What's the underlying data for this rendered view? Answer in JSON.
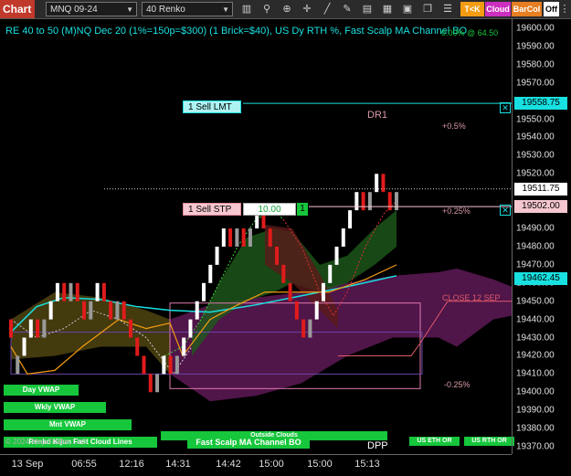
{
  "toolbar": {
    "title": "Chart",
    "instrument": "MNQ 09-24",
    "bar_type": "40 Renko",
    "tk_label": "T<K",
    "cloud_label": "Cloud",
    "barcol_label": "BarCol",
    "off_label": "Off",
    "colors": {
      "title_bg": "#c0392b",
      "tk": "#f39c12",
      "cloud": "#cc2fbf",
      "barcol": "#e67e22"
    }
  },
  "chart_title": "RE 40 to 50 (M)NQ Dec 20 (1%=150p=$300) (1 Brick=$40), US Dy RTH %, Fast Scalp MA Channel BO",
  "overlay_top_right": "0.00% @ 64.50",
  "price_axis": {
    "ticks": [
      "19600.00",
      "19590.00",
      "19580.00",
      "19570.00",
      "19560.00",
      "19550.00",
      "19540.00",
      "19530.00",
      "19520.00",
      "19510.00",
      "19500.00",
      "19490.00",
      "19480.00",
      "19470.00",
      "19460.00",
      "19450.00",
      "19440.00",
      "19430.00",
      "19420.00",
      "19410.00",
      "19400.00",
      "19390.00",
      "19380.00",
      "19370.00"
    ],
    "flags": [
      {
        "label": "19558.75",
        "price": 19558.75,
        "bg": "#18e0e0",
        "fg": "#000"
      },
      {
        "label": "19511.75",
        "price": 19511.75,
        "bg": "#ffffff",
        "fg": "#000"
      },
      {
        "label": "19502.00",
        "price": 19502.0,
        "bg": "#f6c7cf",
        "fg": "#000"
      },
      {
        "label": "19462.45",
        "price": 19462.45,
        "bg": "#18e0e0",
        "fg": "#000"
      }
    ]
  },
  "time_axis": [
    "13 Sep",
    "06:55",
    "12:16",
    "14:31",
    "14:42",
    "15:00",
    "15:00",
    "15:13"
  ],
  "orders": {
    "sell_lmt": {
      "label": "1 Sell LMT",
      "price": 19558.75
    },
    "sell_stp": {
      "label": "1 Sell STP",
      "qty": "10.00",
      "count": "1",
      "price": 19502.0
    }
  },
  "annotations": {
    "dr1": "DR1",
    "plus_half": "+0.5%",
    "plus_quarter": "+0.25%",
    "close_label": "CLOSE 12 SEP",
    "minus_quarter": "-0.25%",
    "dpp": "DPP",
    "copyright": "© 2024 NinjaTrader, LLC"
  },
  "vwaps": [
    "Day VWAP",
    "Wkly VWAP",
    "Mnt VWAP"
  ],
  "bottom_tags": {
    "renko_kijun": "Renko Kijun Fast Cloud Lines",
    "outside_clouds": "Outside Clouds",
    "fast_scalp": "Fast Scalp MA Channel BO",
    "us_eth": "US ETH OR",
    "us_rth": "US RTH OR"
  },
  "chart_data": {
    "type": "candlestick",
    "brick_size": 10,
    "bricks": [
      [
        19430,
        "d"
      ],
      [
        19420,
        "u"
      ],
      [
        19430,
        "u"
      ],
      [
        19440,
        "u"
      ],
      [
        19430,
        "d"
      ],
      [
        19440,
        "u"
      ],
      [
        19450,
        "u"
      ],
      [
        19460,
        "u"
      ],
      [
        19450,
        "d"
      ],
      [
        19460,
        "u"
      ],
      [
        19450,
        "d"
      ],
      [
        19440,
        "d"
      ],
      [
        19450,
        "u"
      ],
      [
        19460,
        "u"
      ],
      [
        19450,
        "d"
      ],
      [
        19440,
        "d"
      ],
      [
        19450,
        "u"
      ],
      [
        19440,
        "d"
      ],
      [
        19430,
        "d"
      ],
      [
        19420,
        "d"
      ],
      [
        19410,
        "d"
      ],
      [
        19400,
        "d"
      ],
      [
        19410,
        "u"
      ],
      [
        19420,
        "u"
      ],
      [
        19410,
        "d"
      ],
      [
        19420,
        "u"
      ],
      [
        19430,
        "u"
      ],
      [
        19440,
        "u"
      ],
      [
        19450,
        "u"
      ],
      [
        19460,
        "u"
      ],
      [
        19470,
        "u"
      ],
      [
        19480,
        "u"
      ],
      [
        19490,
        "u"
      ],
      [
        19480,
        "d"
      ],
      [
        19490,
        "u"
      ],
      [
        19480,
        "d"
      ],
      [
        19490,
        "u"
      ],
      [
        19500,
        "u"
      ],
      [
        19490,
        "d"
      ],
      [
        19480,
        "d"
      ],
      [
        19470,
        "d"
      ],
      [
        19460,
        "d"
      ],
      [
        19450,
        "d"
      ],
      [
        19440,
        "d"
      ],
      [
        19430,
        "d"
      ],
      [
        19440,
        "u"
      ],
      [
        19450,
        "u"
      ],
      [
        19460,
        "u"
      ],
      [
        19470,
        "u"
      ],
      [
        19480,
        "u"
      ],
      [
        19490,
        "u"
      ],
      [
        19500,
        "u"
      ],
      [
        19510,
        "u"
      ],
      [
        19500,
        "d"
      ],
      [
        19510,
        "u"
      ],
      [
        19520,
        "u"
      ],
      [
        19510,
        "d"
      ],
      [
        19500,
        "d"
      ],
      [
        19510,
        "u"
      ]
    ],
    "ylim": [
      19366,
      19605
    ],
    "levels": {
      "sell_lmt": 19558.75,
      "sell_stp": 19502.0,
      "last": 19511.75,
      "cyan_ma": 19462.45
    }
  }
}
